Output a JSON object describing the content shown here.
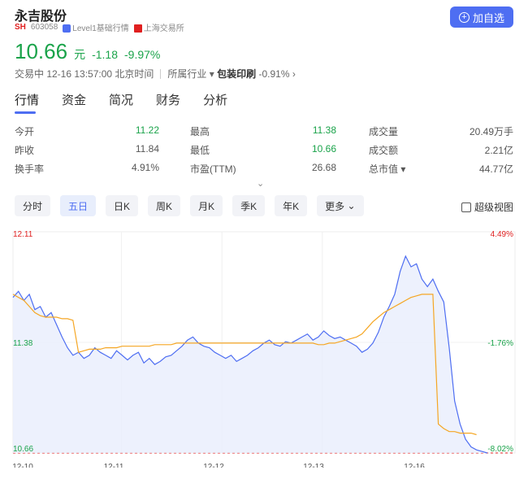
{
  "header": {
    "name": "永吉股份",
    "market": "SH",
    "code": "603058",
    "level_label": "Level1基础行情",
    "exchange": "上海交易所",
    "add_button": "加自选"
  },
  "quote": {
    "price": "10.66",
    "unit": "元",
    "change": "-1.18",
    "change_pct": "-9.97%",
    "status": "交易中 12-16 13:57:00 北京时间",
    "industry_label": "所属行业",
    "industry_name": "包装印刷",
    "industry_change": "-0.91%"
  },
  "tabs": [
    "行情",
    "资金",
    "简况",
    "财务",
    "分析"
  ],
  "stats": [
    [
      {
        "k": "今开",
        "v": "11.22",
        "c": "green"
      },
      {
        "k": "最高",
        "v": "11.38",
        "c": "green"
      },
      {
        "k": "成交量",
        "v": "20.49万手",
        "c": ""
      }
    ],
    [
      {
        "k": "昨收",
        "v": "11.84",
        "c": ""
      },
      {
        "k": "最低",
        "v": "10.66",
        "c": "green"
      },
      {
        "k": "成交额",
        "v": "2.21亿",
        "c": ""
      }
    ],
    [
      {
        "k": "换手率",
        "v": "4.91%",
        "c": ""
      },
      {
        "k": "市盈(TTM)",
        "v": "26.68",
        "c": ""
      },
      {
        "k": "总市值",
        "v": "44.77亿",
        "c": ""
      }
    ]
  ],
  "periods": [
    "分时",
    "五日",
    "日K",
    "周K",
    "月K",
    "季K",
    "年K",
    "更多"
  ],
  "super_view": "超级视图",
  "chart_data": {
    "type": "line",
    "y_labels": [
      "12.11",
      "11.38",
      "10.66"
    ],
    "pct_labels": [
      "4.49%",
      "-1.76%",
      "-8.02%"
    ],
    "x_labels": [
      "12-10",
      "12-11",
      "12-12",
      "12-13",
      "12-16"
    ],
    "ylim": [
      10.66,
      12.11
    ],
    "series": [
      {
        "values": [
          11.68,
          11.72,
          11.66,
          11.7,
          11.6,
          11.62,
          11.55,
          11.58,
          11.5,
          11.42,
          11.35,
          11.3,
          11.32,
          11.28,
          11.3,
          11.35,
          11.32,
          11.3,
          11.28,
          11.33,
          11.3,
          11.27,
          11.3,
          11.32,
          11.25,
          11.28,
          11.24,
          11.26,
          11.29,
          11.3,
          11.33,
          11.36,
          11.4,
          11.42,
          11.38,
          11.36,
          11.35,
          11.32,
          11.3,
          11.28,
          11.3,
          11.26,
          11.28,
          11.3,
          11.33,
          11.35,
          11.38,
          11.4,
          11.37,
          11.36,
          11.39,
          11.38,
          11.4,
          11.42,
          11.44,
          11.4,
          11.42,
          11.46,
          11.43,
          11.41,
          11.42,
          11.4,
          11.38,
          11.36,
          11.32,
          11.34,
          11.38,
          11.45,
          11.55,
          11.62,
          11.7,
          11.85,
          11.95,
          11.88,
          11.9,
          11.8,
          11.75,
          11.8,
          11.72,
          11.65,
          11.35,
          11.0,
          10.85,
          10.75,
          10.7,
          10.68,
          10.67,
          10.66
        ]
      },
      {
        "values": [
          11.7,
          11.68,
          11.66,
          11.62,
          11.58,
          11.56,
          11.55,
          11.55,
          11.55,
          11.54,
          11.54,
          11.53,
          11.32,
          11.33,
          11.34,
          11.34,
          11.34,
          11.35,
          11.35,
          11.35,
          11.36,
          11.36,
          11.36,
          11.36,
          11.36,
          11.36,
          11.37,
          11.37,
          11.37,
          11.37,
          11.38,
          11.38,
          11.38,
          11.38,
          11.38,
          11.38,
          11.38,
          11.38,
          11.38,
          11.38,
          11.38,
          11.38,
          11.38,
          11.38,
          11.38,
          11.38,
          11.38,
          11.38,
          11.38,
          11.38,
          11.38,
          11.38,
          11.38,
          11.38,
          11.38,
          11.38,
          11.37,
          11.37,
          11.38,
          11.38,
          11.39,
          11.4,
          11.41,
          11.42,
          11.44,
          11.48,
          11.52,
          11.55,
          11.58,
          11.6,
          11.62,
          11.64,
          11.66,
          11.68,
          11.69,
          11.7,
          11.7,
          11.7,
          10.85,
          10.82,
          10.8,
          10.8,
          10.79,
          10.79,
          10.79,
          10.78
        ]
      }
    ],
    "colors": {
      "price": "#4e6ef2",
      "avg": "#f5a623",
      "fill": "#e9edfd",
      "down": "#1aa34a",
      "up": "#e02020"
    }
  }
}
